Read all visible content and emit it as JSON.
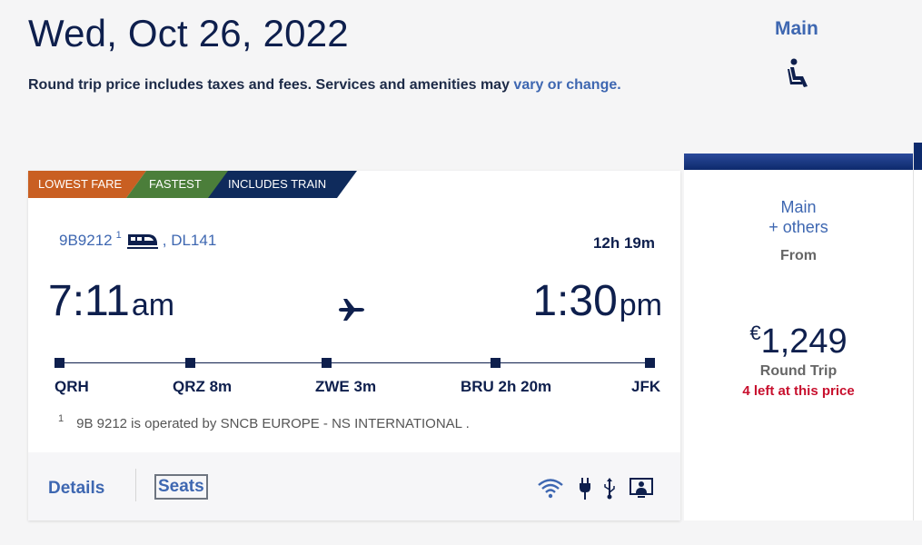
{
  "header": {
    "date": "Wed, Oct 26, 2022",
    "subtitle_text": "Round trip price includes taxes and fees. Services and amenities may ",
    "subtitle_link": "vary or change.",
    "cabin_title": "Main",
    "cabin_icon": "seat-icon"
  },
  "tags": [
    "LOWEST FARE",
    "FASTEST",
    "INCLUDES TRAIN"
  ],
  "flight": {
    "segment1": "9B9212",
    "segment1_note": "1",
    "train_icon": "train-icon",
    "segment2": ", DL141",
    "duration": "12h 19m",
    "departure_time": "7:11",
    "departure_ampm": "am",
    "arrival_time": "1:30",
    "arrival_ampm": "pm",
    "plane_icon": "plane-icon",
    "stops": [
      {
        "code": "QRH"
      },
      {
        "code": "QRZ 8m"
      },
      {
        "code": "ZWE 3m"
      },
      {
        "code": "BRU 2h 20m"
      },
      {
        "code": "JFK"
      }
    ],
    "footnote_mark": "1",
    "footnote": "9B 9212 is operated by SNCB EUROPE - NS INTERNATIONAL ."
  },
  "footer": {
    "details": "Details",
    "seats": "Seats",
    "amenities": [
      "wifi-icon",
      "power-plug-icon",
      "usb-icon",
      "personal-screen-icon"
    ]
  },
  "price_column": {
    "fare_line1": "Main",
    "fare_line2": "+ others",
    "from": "From",
    "currency": "€",
    "amount": "1,249",
    "trip_type": "Round Trip",
    "availability": "4 left at this price"
  },
  "colors": {
    "navy": "#0e1f4d",
    "link_blue": "#3e67b1",
    "lowest_fare": "#c95f22",
    "fastest": "#4b7e3a",
    "includes_train": "#0f2b5c",
    "alert_red": "#c8102e"
  }
}
